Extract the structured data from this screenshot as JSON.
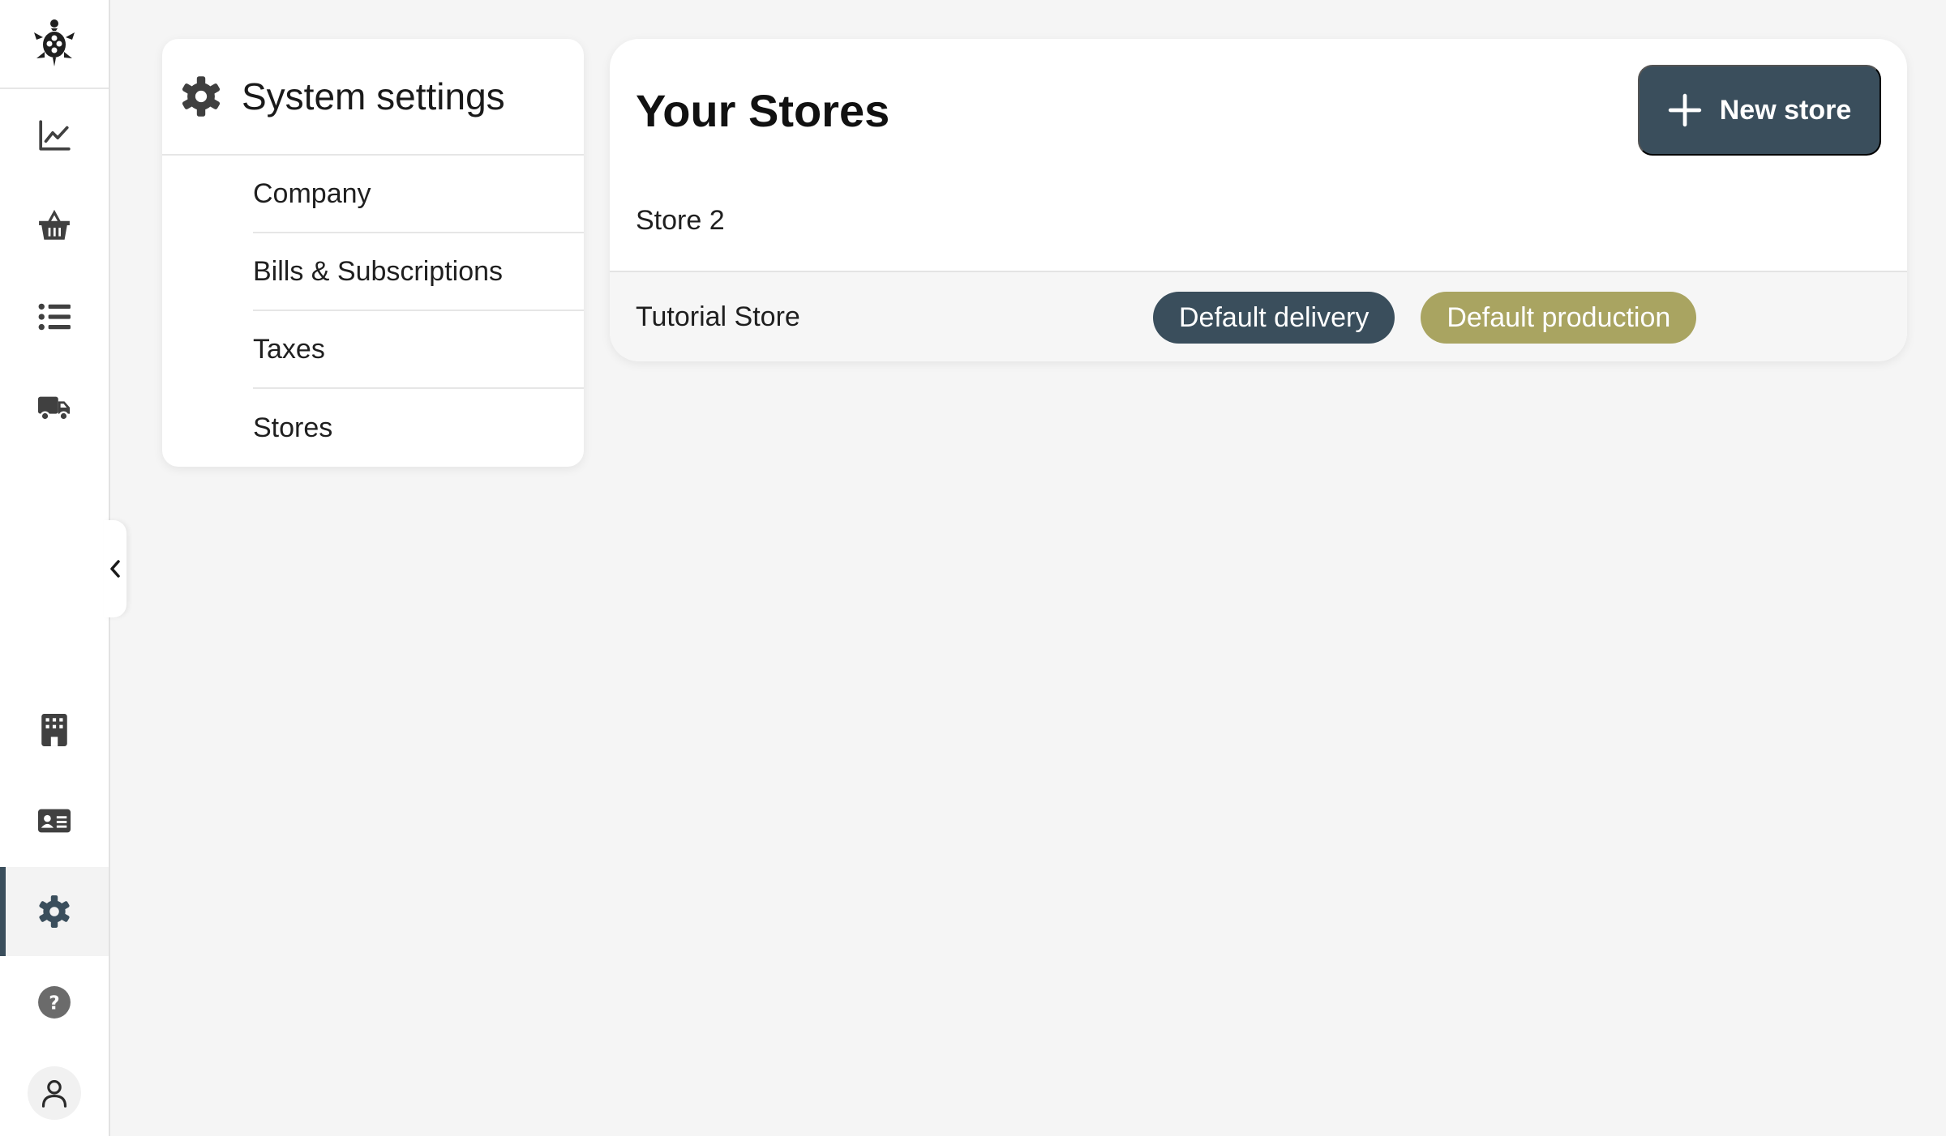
{
  "rail": {
    "logo": "turtle-logo-icon",
    "top_items": [
      "chart-icon",
      "basket-icon",
      "list-icon",
      "truck-icon"
    ],
    "bottom_items": [
      "building-icon",
      "id-card-icon",
      "gear-icon",
      "help-icon",
      "user-icon"
    ],
    "active_item": "gear-icon"
  },
  "settings_nav": {
    "title": "System settings",
    "links": [
      {
        "label": "Company"
      },
      {
        "label": "Bills & Subscriptions"
      },
      {
        "label": "Taxes"
      },
      {
        "label": "Stores"
      }
    ]
  },
  "stores": {
    "title": "Your Stores",
    "new_button_label": "New store",
    "rows": [
      {
        "name": "Store 2",
        "badges": []
      },
      {
        "name": "Tutorial Store",
        "badges": [
          {
            "label": "Default delivery",
            "color": "#3a4e5c"
          },
          {
            "label": "Default production",
            "color": "#a9a461"
          }
        ]
      }
    ]
  },
  "colors": {
    "accent": "#3a4e5c",
    "production_badge": "#a9a461",
    "background": "#f5f5f5"
  }
}
